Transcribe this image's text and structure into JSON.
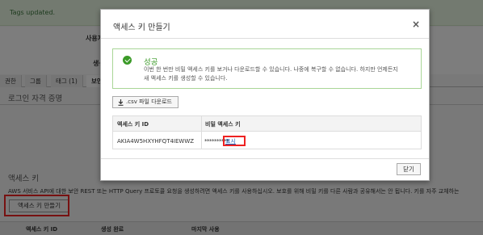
{
  "background": {
    "flash_message": "Tags updated.",
    "summary_user_label": "사용자",
    "summary_created_label": "생성",
    "tabs": [
      {
        "label": "권한"
      },
      {
        "label": "그룹"
      },
      {
        "label": "태그 (1)"
      },
      {
        "label": "보안"
      }
    ],
    "credentials_title": "로그인 자격 증명",
    "access_keys_title": "액세스 키",
    "access_keys_description": "AWS 서비스 API에 대한 보안 REST 또는 HTTP Query 프로토콜 요청을 생성하려면 액세스 키를 사용하십시오. 보호를 위해 비밀 키를 다른 사람과 공유해서는 안 됩니다. 키를 자주 교체하는",
    "create_key_button": "액세스 키 만들기",
    "table_headers": [
      "액세스 키 ID",
      "생성 완료",
      "마지막 사용"
    ]
  },
  "modal": {
    "title": "액세스 키 만들기",
    "close_icon": "×",
    "success": {
      "title": "성공",
      "line1": "이번 한 번만 비밀 액세스 키를 보거나 다운로드할 수 있습니다. 나중에 복구할 수 없습니다. 하지만 언제든지",
      "line2": "새 액세스 키를 생성할 수 있습니다."
    },
    "download_button": ".csv 파일 다운로드",
    "table": {
      "headers": [
        "액세스 키 ID",
        "비밀 액세스 키"
      ],
      "row": {
        "access_key_id": "AKIA4W5HXYHFQT4IEWWZ",
        "secret_mask": "**********",
        "show_link": "표시"
      }
    },
    "close_button": "닫기"
  },
  "colors": {
    "success_green": "#3b9a28",
    "highlight_red": "#e22",
    "link_blue": "#1a5bb5"
  }
}
